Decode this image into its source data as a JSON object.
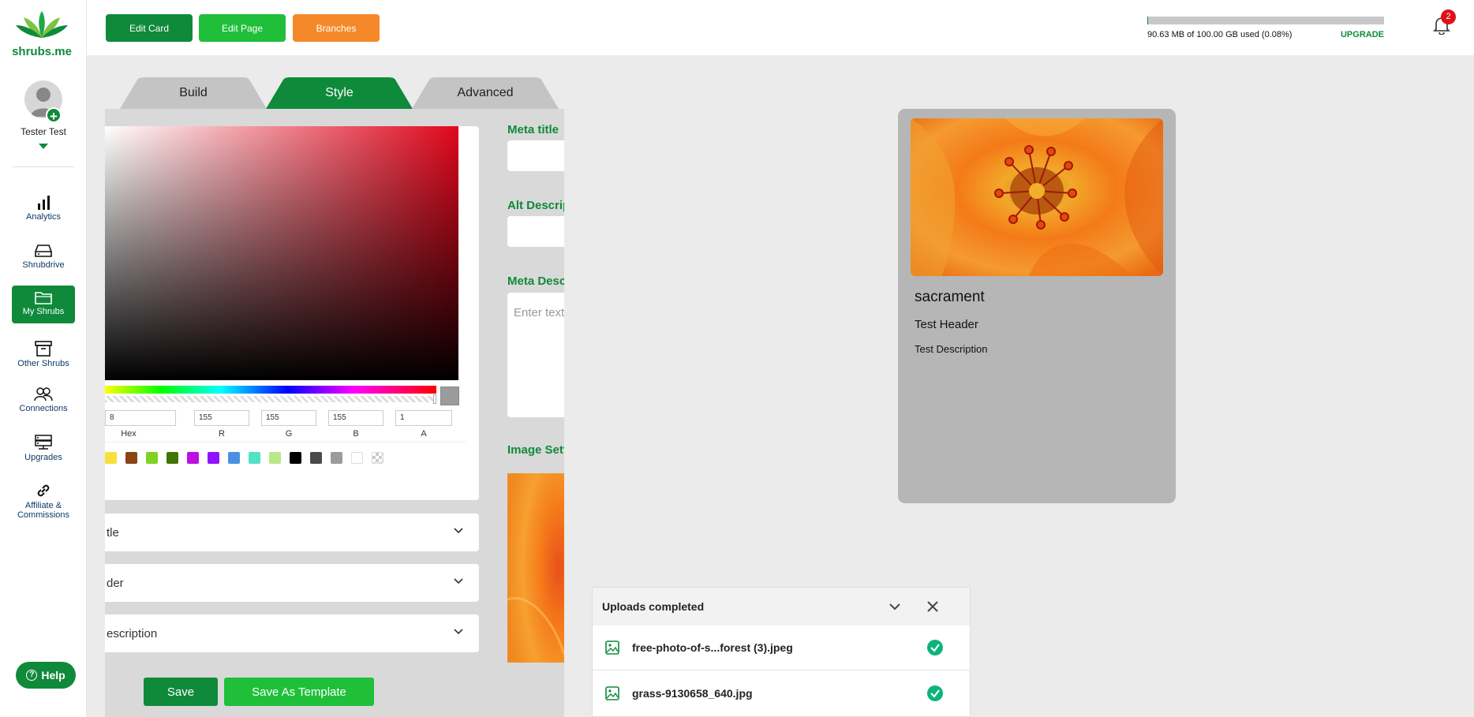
{
  "app": {
    "logo_text": "shrubs.me"
  },
  "profile": {
    "name": "Tester Test"
  },
  "nav": [
    {
      "label": "Analytics",
      "icon": "bar-chart-icon"
    },
    {
      "label": "Shrubdrive",
      "icon": "hard-drive-icon"
    },
    {
      "label": "My Shrubs",
      "icon": "folder-icon",
      "active": true
    },
    {
      "label": "Other Shrubs",
      "icon": "archive-icon"
    },
    {
      "label": "Connections",
      "icon": "users-icon"
    },
    {
      "label": "Upgrades",
      "icon": "server-icon"
    },
    {
      "label1": "Affiliate &",
      "label2": "Commissions",
      "icon": "link-icon"
    }
  ],
  "help": {
    "label": "Help"
  },
  "toolbar": {
    "edit_card": "Edit Card",
    "edit_page": "Edit Page",
    "branches": "Branches"
  },
  "storage": {
    "text": "90.63 MB of 100.00 GB used (0.08%)",
    "percent_used": 0.08,
    "upgrade": "UPGRADE"
  },
  "notifications": {
    "count": "2"
  },
  "tabs": {
    "build": "Build",
    "style": "Style",
    "advanced": "Advanced",
    "active": "Style"
  },
  "color_picker": {
    "hex_value": "8",
    "r": "155",
    "g": "155",
    "b": "155",
    "a": "1",
    "labels": {
      "hex": "Hex",
      "r": "R",
      "g": "G",
      "b": "B",
      "a": "A"
    },
    "current_color": "#9b9b9b",
    "presets": [
      "#f8e03b",
      "#8b4513",
      "#7ed321",
      "#417505",
      "#bd10e0",
      "#9013fe",
      "#4a90e2",
      "#50e3c2",
      "#b8e986",
      "#000000",
      "#4a4a4a",
      "#9b9b9b",
      "#ffffff",
      "transparent"
    ]
  },
  "accordions": {
    "title": "tle",
    "header": "der",
    "description": "escription"
  },
  "actions": {
    "save": "Save",
    "save_template": "Save As Template"
  },
  "meta": {
    "title_label": "Meta title",
    "alt_label": "Alt Descrip",
    "desc_label": "Meta Descr",
    "desc_placeholder": "Enter text",
    "image_label": "Image Sett"
  },
  "card": {
    "title": "sacrament",
    "header": "Test Header",
    "description": "Test Description"
  },
  "uploads": {
    "title": "Uploads completed",
    "files": [
      {
        "name": "free-photo-of-s...forest (3).jpeg",
        "status": "complete"
      },
      {
        "name": "grass-9130658_640.jpg",
        "status": "complete"
      }
    ]
  },
  "colors": {
    "brand_green": "#0f8a3a",
    "bright_green": "#1fbf3a",
    "orange": "#f5892a"
  }
}
